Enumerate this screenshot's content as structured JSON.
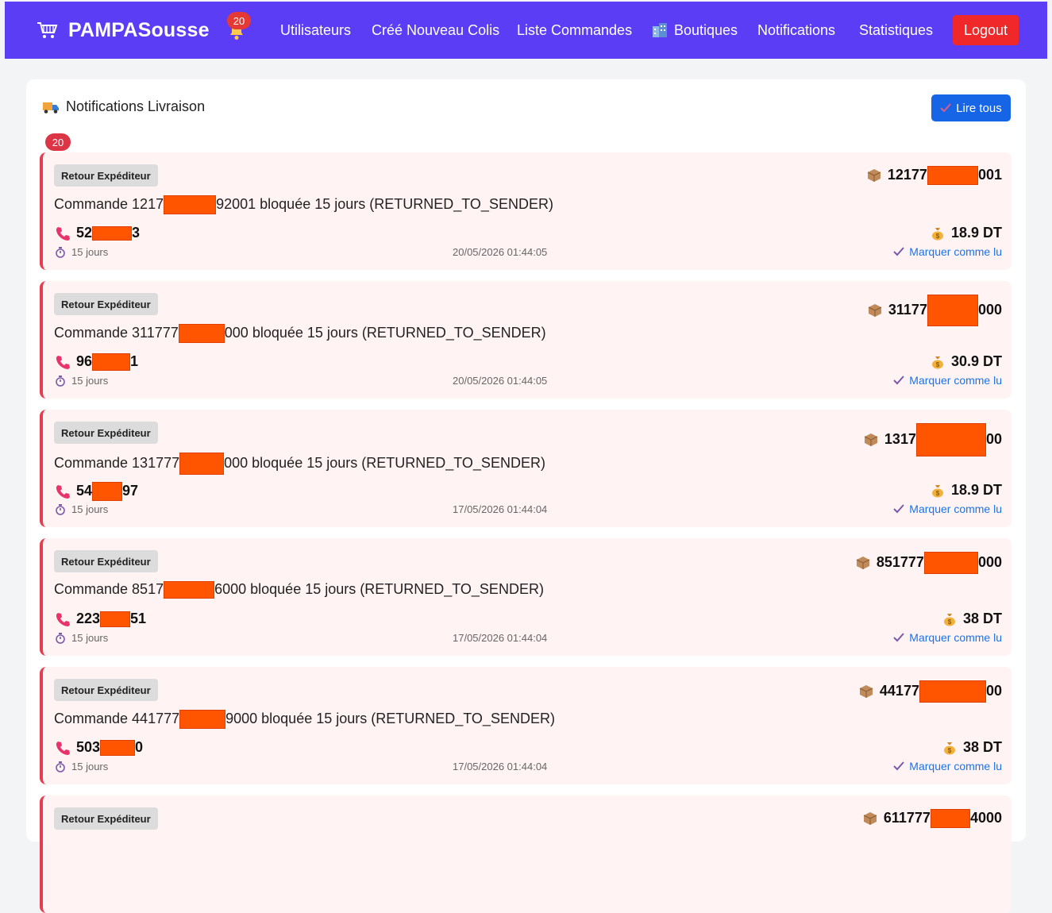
{
  "navbar": {
    "brand": "PAMPASousse",
    "notification_count": "20",
    "links": {
      "users": "Utilisateurs",
      "new_parcel": "Créé Nouveau Colis",
      "orders": "Liste Commandes",
      "shops": "Boutiques",
      "notifications": "Notifications",
      "stats": "Statistiques"
    },
    "logout": "Logout"
  },
  "panel": {
    "title": "Notifications Livraison",
    "read_all": "Lire tous",
    "count": "20"
  },
  "notifications": [
    {
      "tag": "Retour Expéditeur",
      "msg_prefix": "Commande 1217",
      "msg_suffix": "92001 bloquée 15 jours (RETURNED_TO_SENDER)",
      "phone_prefix": "52",
      "phone_suffix": "3",
      "delay": "15 jours",
      "date": "20/05/2026 01:44:05",
      "ref_prefix": "12177",
      "ref_suffix": "001",
      "price": "18.9 DT",
      "mark": "Marquer comme lu"
    },
    {
      "tag": "Retour Expéditeur",
      "msg_prefix": "Commande 311777",
      "msg_suffix": "000 bloquée 15 jours (RETURNED_TO_SENDER)",
      "phone_prefix": "96",
      "phone_suffix": "1",
      "delay": "15 jours",
      "date": "20/05/2026 01:44:05",
      "ref_prefix": "31177",
      "ref_suffix": "000",
      "price": "30.9 DT",
      "mark": "Marquer comme lu"
    },
    {
      "tag": "Retour Expéditeur",
      "msg_prefix": "Commande 131777",
      "msg_suffix": "000 bloquée 15 jours (RETURNED_TO_SENDER)",
      "phone_prefix": "54",
      "phone_suffix": "97",
      "delay": "15 jours",
      "date": "17/05/2026 01:44:04",
      "ref_prefix": "1317",
      "ref_suffix": "00",
      "price": "18.9 DT",
      "mark": "Marquer comme lu"
    },
    {
      "tag": "Retour Expéditeur",
      "msg_prefix": "Commande 8517",
      "msg_suffix": "6000 bloquée 15 jours (RETURNED_TO_SENDER)",
      "phone_prefix": "223",
      "phone_suffix": "51",
      "delay": "15 jours",
      "date": "17/05/2026 01:44:04",
      "ref_prefix": "851777",
      "ref_suffix": "000",
      "price": "38 DT",
      "mark": "Marquer comme lu"
    },
    {
      "tag": "Retour Expéditeur",
      "msg_prefix": "Commande 441777",
      "msg_suffix": "9000 bloquée 15 jours (RETURNED_TO_SENDER)",
      "phone_prefix": "503",
      "phone_suffix": "0",
      "delay": "15 jours",
      "date": "17/05/2026 01:44:04",
      "ref_prefix": "44177",
      "ref_suffix": "00",
      "price": "38 DT",
      "mark": "Marquer comme lu"
    },
    {
      "tag": "Retour Expéditeur",
      "msg_prefix": "",
      "msg_suffix": "",
      "phone_prefix": "",
      "phone_suffix": "",
      "delay": "",
      "date": "",
      "ref_prefix": "611777",
      "ref_suffix": "4000",
      "price": "",
      "mark": ""
    }
  ],
  "colors": {
    "navbar": "#5b3df5",
    "logout": "#f0282a",
    "accent_blue": "#1565e6",
    "card_border": "#e53e50",
    "card_bg": "#fff3f3",
    "badge": "#dc3545",
    "redaction": "#ff5500"
  },
  "icons": {
    "brand": "shopping-cart-icon",
    "bell": "bell-icon",
    "shops": "buildings-icon",
    "panel": "delivery-truck-icon",
    "read_all": "check-icon",
    "ref": "package-icon",
    "phone": "phone-icon",
    "delay": "stopwatch-icon",
    "price": "money-bag-icon",
    "mark_read": "check-icon"
  }
}
